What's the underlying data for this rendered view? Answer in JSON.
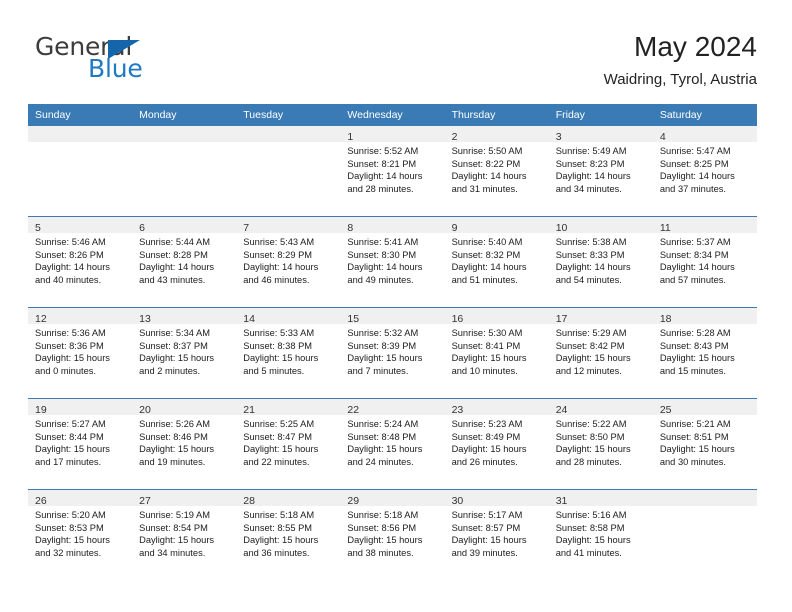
{
  "brand": {
    "name_top": "General",
    "name_bottom": "Blue",
    "triangle_icon": "triangle-icon",
    "color_top": "#3c3c3c",
    "color_bottom": "#1f7ac4",
    "triangle_color": "#1565ad"
  },
  "header": {
    "title": "May 2024",
    "subtitle": "Waidring, Tyrol, Austria"
  },
  "theme": {
    "header_bar_color": "#3b7bb5",
    "day_band_color": "#f0f0f0",
    "row_divider_color": "#3b7bb5",
    "text_color": "#1c1c1c"
  },
  "calendar": {
    "weekdays": [
      "Sunday",
      "Monday",
      "Tuesday",
      "Wednesday",
      "Thursday",
      "Friday",
      "Saturday"
    ],
    "weeks": [
      [
        {
          "day": "",
          "sunrise": "",
          "sunset": "",
          "daylight_line1": "",
          "daylight_line2": ""
        },
        {
          "day": "",
          "sunrise": "",
          "sunset": "",
          "daylight_line1": "",
          "daylight_line2": ""
        },
        {
          "day": "",
          "sunrise": "",
          "sunset": "",
          "daylight_line1": "",
          "daylight_line2": ""
        },
        {
          "day": "1",
          "sunrise": "Sunrise: 5:52 AM",
          "sunset": "Sunset: 8:21 PM",
          "daylight_line1": "Daylight: 14 hours",
          "daylight_line2": "and 28 minutes."
        },
        {
          "day": "2",
          "sunrise": "Sunrise: 5:50 AM",
          "sunset": "Sunset: 8:22 PM",
          "daylight_line1": "Daylight: 14 hours",
          "daylight_line2": "and 31 minutes."
        },
        {
          "day": "3",
          "sunrise": "Sunrise: 5:49 AM",
          "sunset": "Sunset: 8:23 PM",
          "daylight_line1": "Daylight: 14 hours",
          "daylight_line2": "and 34 minutes."
        },
        {
          "day": "4",
          "sunrise": "Sunrise: 5:47 AM",
          "sunset": "Sunset: 8:25 PM",
          "daylight_line1": "Daylight: 14 hours",
          "daylight_line2": "and 37 minutes."
        }
      ],
      [
        {
          "day": "5",
          "sunrise": "Sunrise: 5:46 AM",
          "sunset": "Sunset: 8:26 PM",
          "daylight_line1": "Daylight: 14 hours",
          "daylight_line2": "and 40 minutes."
        },
        {
          "day": "6",
          "sunrise": "Sunrise: 5:44 AM",
          "sunset": "Sunset: 8:28 PM",
          "daylight_line1": "Daylight: 14 hours",
          "daylight_line2": "and 43 minutes."
        },
        {
          "day": "7",
          "sunrise": "Sunrise: 5:43 AM",
          "sunset": "Sunset: 8:29 PM",
          "daylight_line1": "Daylight: 14 hours",
          "daylight_line2": "and 46 minutes."
        },
        {
          "day": "8",
          "sunrise": "Sunrise: 5:41 AM",
          "sunset": "Sunset: 8:30 PM",
          "daylight_line1": "Daylight: 14 hours",
          "daylight_line2": "and 49 minutes."
        },
        {
          "day": "9",
          "sunrise": "Sunrise: 5:40 AM",
          "sunset": "Sunset: 8:32 PM",
          "daylight_line1": "Daylight: 14 hours",
          "daylight_line2": "and 51 minutes."
        },
        {
          "day": "10",
          "sunrise": "Sunrise: 5:38 AM",
          "sunset": "Sunset: 8:33 PM",
          "daylight_line1": "Daylight: 14 hours",
          "daylight_line2": "and 54 minutes."
        },
        {
          "day": "11",
          "sunrise": "Sunrise: 5:37 AM",
          "sunset": "Sunset: 8:34 PM",
          "daylight_line1": "Daylight: 14 hours",
          "daylight_line2": "and 57 minutes."
        }
      ],
      [
        {
          "day": "12",
          "sunrise": "Sunrise: 5:36 AM",
          "sunset": "Sunset: 8:36 PM",
          "daylight_line1": "Daylight: 15 hours",
          "daylight_line2": "and 0 minutes."
        },
        {
          "day": "13",
          "sunrise": "Sunrise: 5:34 AM",
          "sunset": "Sunset: 8:37 PM",
          "daylight_line1": "Daylight: 15 hours",
          "daylight_line2": "and 2 minutes."
        },
        {
          "day": "14",
          "sunrise": "Sunrise: 5:33 AM",
          "sunset": "Sunset: 8:38 PM",
          "daylight_line1": "Daylight: 15 hours",
          "daylight_line2": "and 5 minutes."
        },
        {
          "day": "15",
          "sunrise": "Sunrise: 5:32 AM",
          "sunset": "Sunset: 8:39 PM",
          "daylight_line1": "Daylight: 15 hours",
          "daylight_line2": "and 7 minutes."
        },
        {
          "day": "16",
          "sunrise": "Sunrise: 5:30 AM",
          "sunset": "Sunset: 8:41 PM",
          "daylight_line1": "Daylight: 15 hours",
          "daylight_line2": "and 10 minutes."
        },
        {
          "day": "17",
          "sunrise": "Sunrise: 5:29 AM",
          "sunset": "Sunset: 8:42 PM",
          "daylight_line1": "Daylight: 15 hours",
          "daylight_line2": "and 12 minutes."
        },
        {
          "day": "18",
          "sunrise": "Sunrise: 5:28 AM",
          "sunset": "Sunset: 8:43 PM",
          "daylight_line1": "Daylight: 15 hours",
          "daylight_line2": "and 15 minutes."
        }
      ],
      [
        {
          "day": "19",
          "sunrise": "Sunrise: 5:27 AM",
          "sunset": "Sunset: 8:44 PM",
          "daylight_line1": "Daylight: 15 hours",
          "daylight_line2": "and 17 minutes."
        },
        {
          "day": "20",
          "sunrise": "Sunrise: 5:26 AM",
          "sunset": "Sunset: 8:46 PM",
          "daylight_line1": "Daylight: 15 hours",
          "daylight_line2": "and 19 minutes."
        },
        {
          "day": "21",
          "sunrise": "Sunrise: 5:25 AM",
          "sunset": "Sunset: 8:47 PM",
          "daylight_line1": "Daylight: 15 hours",
          "daylight_line2": "and 22 minutes."
        },
        {
          "day": "22",
          "sunrise": "Sunrise: 5:24 AM",
          "sunset": "Sunset: 8:48 PM",
          "daylight_line1": "Daylight: 15 hours",
          "daylight_line2": "and 24 minutes."
        },
        {
          "day": "23",
          "sunrise": "Sunrise: 5:23 AM",
          "sunset": "Sunset: 8:49 PM",
          "daylight_line1": "Daylight: 15 hours",
          "daylight_line2": "and 26 minutes."
        },
        {
          "day": "24",
          "sunrise": "Sunrise: 5:22 AM",
          "sunset": "Sunset: 8:50 PM",
          "daylight_line1": "Daylight: 15 hours",
          "daylight_line2": "and 28 minutes."
        },
        {
          "day": "25",
          "sunrise": "Sunrise: 5:21 AM",
          "sunset": "Sunset: 8:51 PM",
          "daylight_line1": "Daylight: 15 hours",
          "daylight_line2": "and 30 minutes."
        }
      ],
      [
        {
          "day": "26",
          "sunrise": "Sunrise: 5:20 AM",
          "sunset": "Sunset: 8:53 PM",
          "daylight_line1": "Daylight: 15 hours",
          "daylight_line2": "and 32 minutes."
        },
        {
          "day": "27",
          "sunrise": "Sunrise: 5:19 AM",
          "sunset": "Sunset: 8:54 PM",
          "daylight_line1": "Daylight: 15 hours",
          "daylight_line2": "and 34 minutes."
        },
        {
          "day": "28",
          "sunrise": "Sunrise: 5:18 AM",
          "sunset": "Sunset: 8:55 PM",
          "daylight_line1": "Daylight: 15 hours",
          "daylight_line2": "and 36 minutes."
        },
        {
          "day": "29",
          "sunrise": "Sunrise: 5:18 AM",
          "sunset": "Sunset: 8:56 PM",
          "daylight_line1": "Daylight: 15 hours",
          "daylight_line2": "and 38 minutes."
        },
        {
          "day": "30",
          "sunrise": "Sunrise: 5:17 AM",
          "sunset": "Sunset: 8:57 PM",
          "daylight_line1": "Daylight: 15 hours",
          "daylight_line2": "and 39 minutes."
        },
        {
          "day": "31",
          "sunrise": "Sunrise: 5:16 AM",
          "sunset": "Sunset: 8:58 PM",
          "daylight_line1": "Daylight: 15 hours",
          "daylight_line2": "and 41 minutes."
        },
        {
          "day": "",
          "sunrise": "",
          "sunset": "",
          "daylight_line1": "",
          "daylight_line2": ""
        }
      ]
    ]
  }
}
